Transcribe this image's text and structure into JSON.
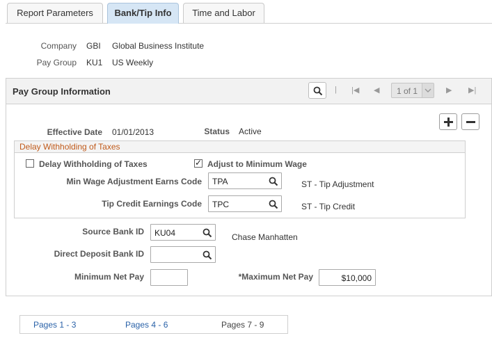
{
  "tabs": [
    {
      "label": "Report Parameters",
      "active": false
    },
    {
      "label": "Bank/Tip Info",
      "active": true
    },
    {
      "label": "Time and Labor",
      "active": false
    }
  ],
  "header": {
    "company_label": "Company",
    "company_code": "GBI",
    "company_name": "Global Business Institute",
    "paygroup_label": "Pay Group",
    "paygroup_code": "KU1",
    "paygroup_name": "US Weekly"
  },
  "group": {
    "title": "Pay Group Information",
    "pager_text": "1 of 1"
  },
  "effective": {
    "date_label": "Effective Date",
    "date_value": "01/01/2013",
    "status_label": "Status",
    "status_value": "Active"
  },
  "delay": {
    "title": "Delay Withholding of Taxes",
    "chk_delay_label": "Delay Withholding of Taxes",
    "chk_delay_checked": false,
    "chk_adjust_label": "Adjust to Minimum Wage",
    "chk_adjust_checked": true,
    "minwage_label": "Min Wage Adjustment Earns Code",
    "minwage_value": "TPA",
    "minwage_desc": "ST - Tip Adjustment",
    "tipcredit_label": "Tip Credit Earnings Code",
    "tipcredit_value": "TPC",
    "tipcredit_desc": "ST - Tip Credit"
  },
  "bank": {
    "source_label": "Source Bank ID",
    "source_value": "KU04",
    "source_desc": "Chase Manhatten",
    "direct_label": "Direct Deposit Bank ID",
    "direct_value": "",
    "minnet_label": "Minimum Net Pay",
    "minnet_value": "",
    "maxnet_label": "*Maximum Net Pay",
    "maxnet_value": "$10,000"
  },
  "pages": [
    {
      "label": "Pages 1 - 3",
      "link": true
    },
    {
      "label": "Pages 4 - 6",
      "link": true
    },
    {
      "label": "Pages 7 - 9",
      "link": false
    }
  ],
  "colors": {
    "link": "#2a62a8",
    "section_title": "#c05a1a",
    "active_tab": "#d6e6f5"
  }
}
